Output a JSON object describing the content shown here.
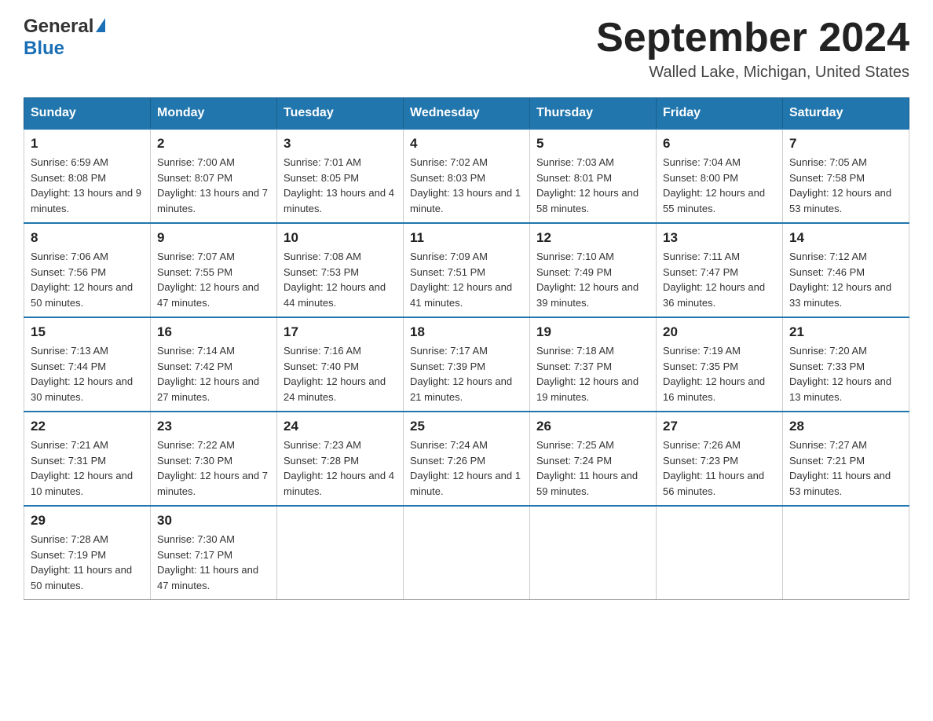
{
  "header": {
    "logo_line1": "General",
    "logo_line2": "Blue",
    "title": "September 2024",
    "location": "Walled Lake, Michigan, United States"
  },
  "days_of_week": [
    "Sunday",
    "Monday",
    "Tuesday",
    "Wednesday",
    "Thursday",
    "Friday",
    "Saturday"
  ],
  "weeks": [
    [
      {
        "day": "1",
        "sunrise": "6:59 AM",
        "sunset": "8:08 PM",
        "daylight": "13 hours and 9 minutes."
      },
      {
        "day": "2",
        "sunrise": "7:00 AM",
        "sunset": "8:07 PM",
        "daylight": "13 hours and 7 minutes."
      },
      {
        "day": "3",
        "sunrise": "7:01 AM",
        "sunset": "8:05 PM",
        "daylight": "13 hours and 4 minutes."
      },
      {
        "day": "4",
        "sunrise": "7:02 AM",
        "sunset": "8:03 PM",
        "daylight": "13 hours and 1 minute."
      },
      {
        "day": "5",
        "sunrise": "7:03 AM",
        "sunset": "8:01 PM",
        "daylight": "12 hours and 58 minutes."
      },
      {
        "day": "6",
        "sunrise": "7:04 AM",
        "sunset": "8:00 PM",
        "daylight": "12 hours and 55 minutes."
      },
      {
        "day": "7",
        "sunrise": "7:05 AM",
        "sunset": "7:58 PM",
        "daylight": "12 hours and 53 minutes."
      }
    ],
    [
      {
        "day": "8",
        "sunrise": "7:06 AM",
        "sunset": "7:56 PM",
        "daylight": "12 hours and 50 minutes."
      },
      {
        "day": "9",
        "sunrise": "7:07 AM",
        "sunset": "7:55 PM",
        "daylight": "12 hours and 47 minutes."
      },
      {
        "day": "10",
        "sunrise": "7:08 AM",
        "sunset": "7:53 PM",
        "daylight": "12 hours and 44 minutes."
      },
      {
        "day": "11",
        "sunrise": "7:09 AM",
        "sunset": "7:51 PM",
        "daylight": "12 hours and 41 minutes."
      },
      {
        "day": "12",
        "sunrise": "7:10 AM",
        "sunset": "7:49 PM",
        "daylight": "12 hours and 39 minutes."
      },
      {
        "day": "13",
        "sunrise": "7:11 AM",
        "sunset": "7:47 PM",
        "daylight": "12 hours and 36 minutes."
      },
      {
        "day": "14",
        "sunrise": "7:12 AM",
        "sunset": "7:46 PM",
        "daylight": "12 hours and 33 minutes."
      }
    ],
    [
      {
        "day": "15",
        "sunrise": "7:13 AM",
        "sunset": "7:44 PM",
        "daylight": "12 hours and 30 minutes."
      },
      {
        "day": "16",
        "sunrise": "7:14 AM",
        "sunset": "7:42 PM",
        "daylight": "12 hours and 27 minutes."
      },
      {
        "day": "17",
        "sunrise": "7:16 AM",
        "sunset": "7:40 PM",
        "daylight": "12 hours and 24 minutes."
      },
      {
        "day": "18",
        "sunrise": "7:17 AM",
        "sunset": "7:39 PM",
        "daylight": "12 hours and 21 minutes."
      },
      {
        "day": "19",
        "sunrise": "7:18 AM",
        "sunset": "7:37 PM",
        "daylight": "12 hours and 19 minutes."
      },
      {
        "day": "20",
        "sunrise": "7:19 AM",
        "sunset": "7:35 PM",
        "daylight": "12 hours and 16 minutes."
      },
      {
        "day": "21",
        "sunrise": "7:20 AM",
        "sunset": "7:33 PM",
        "daylight": "12 hours and 13 minutes."
      }
    ],
    [
      {
        "day": "22",
        "sunrise": "7:21 AM",
        "sunset": "7:31 PM",
        "daylight": "12 hours and 10 minutes."
      },
      {
        "day": "23",
        "sunrise": "7:22 AM",
        "sunset": "7:30 PM",
        "daylight": "12 hours and 7 minutes."
      },
      {
        "day": "24",
        "sunrise": "7:23 AM",
        "sunset": "7:28 PM",
        "daylight": "12 hours and 4 minutes."
      },
      {
        "day": "25",
        "sunrise": "7:24 AM",
        "sunset": "7:26 PM",
        "daylight": "12 hours and 1 minute."
      },
      {
        "day": "26",
        "sunrise": "7:25 AM",
        "sunset": "7:24 PM",
        "daylight": "11 hours and 59 minutes."
      },
      {
        "day": "27",
        "sunrise": "7:26 AM",
        "sunset": "7:23 PM",
        "daylight": "11 hours and 56 minutes."
      },
      {
        "day": "28",
        "sunrise": "7:27 AM",
        "sunset": "7:21 PM",
        "daylight": "11 hours and 53 minutes."
      }
    ],
    [
      {
        "day": "29",
        "sunrise": "7:28 AM",
        "sunset": "7:19 PM",
        "daylight": "11 hours and 50 minutes."
      },
      {
        "day": "30",
        "sunrise": "7:30 AM",
        "sunset": "7:17 PM",
        "daylight": "11 hours and 47 minutes."
      },
      null,
      null,
      null,
      null,
      null
    ]
  ],
  "labels": {
    "sunrise": "Sunrise:",
    "sunset": "Sunset:",
    "daylight": "Daylight:"
  }
}
